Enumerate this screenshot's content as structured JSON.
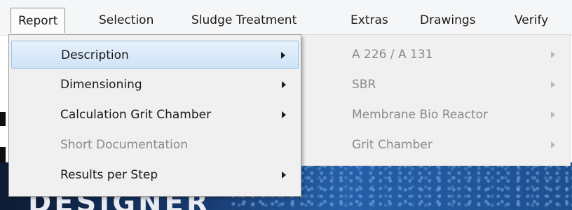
{
  "menubar": {
    "items": [
      {
        "label": "Report"
      },
      {
        "label": "Selection"
      },
      {
        "label": "Sludge Treatment"
      },
      {
        "label": "Extras"
      },
      {
        "label": "Drawings"
      },
      {
        "label": "Verify"
      }
    ]
  },
  "report_menu": {
    "items": [
      {
        "label": "Description",
        "has_submenu": true,
        "enabled": true
      },
      {
        "label": "Dimensioning",
        "has_submenu": true,
        "enabled": true
      },
      {
        "label": "Calculation Grit Chamber",
        "has_submenu": true,
        "enabled": true
      },
      {
        "label": "Short Documentation",
        "has_submenu": false,
        "enabled": false
      },
      {
        "label": "Results per Step",
        "has_submenu": true,
        "enabled": true
      }
    ]
  },
  "description_submenu": {
    "items": [
      {
        "label": "A 226 / A 131"
      },
      {
        "label": "SBR"
      },
      {
        "label": "Membrane Bio Reactor"
      },
      {
        "label": "Grit Chamber"
      }
    ]
  },
  "background": {
    "banner_text": "DESIGNER"
  },
  "colors": {
    "highlight": "#cfe3f7",
    "disabled_text": "#8a8a8a",
    "menu_background": "#f0f0f0"
  }
}
